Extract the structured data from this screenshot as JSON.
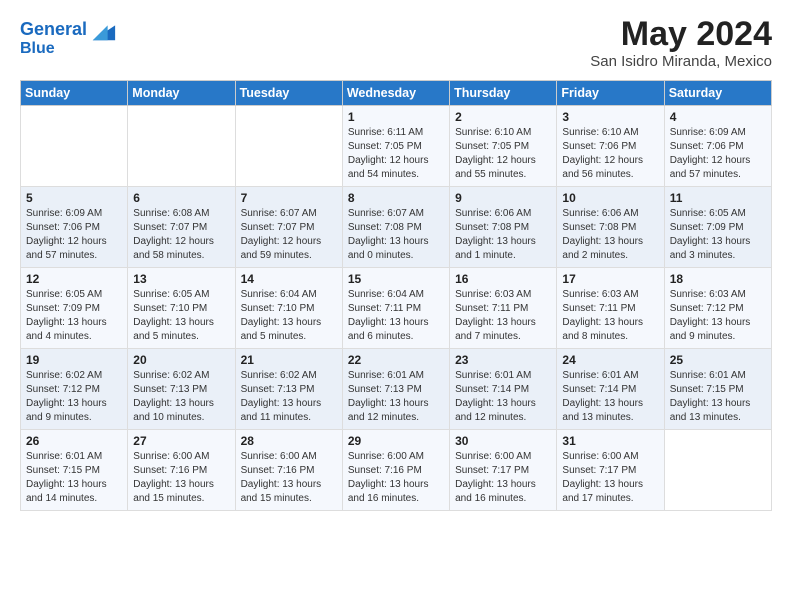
{
  "header": {
    "logo_line1": "General",
    "logo_line2": "Blue",
    "title": "May 2024",
    "subtitle": "San Isidro Miranda, Mexico"
  },
  "days_of_week": [
    "Sunday",
    "Monday",
    "Tuesday",
    "Wednesday",
    "Thursday",
    "Friday",
    "Saturday"
  ],
  "weeks": [
    [
      {
        "num": "",
        "info": ""
      },
      {
        "num": "",
        "info": ""
      },
      {
        "num": "",
        "info": ""
      },
      {
        "num": "1",
        "info": "Sunrise: 6:11 AM\nSunset: 7:05 PM\nDaylight: 12 hours\nand 54 minutes."
      },
      {
        "num": "2",
        "info": "Sunrise: 6:10 AM\nSunset: 7:05 PM\nDaylight: 12 hours\nand 55 minutes."
      },
      {
        "num": "3",
        "info": "Sunrise: 6:10 AM\nSunset: 7:06 PM\nDaylight: 12 hours\nand 56 minutes."
      },
      {
        "num": "4",
        "info": "Sunrise: 6:09 AM\nSunset: 7:06 PM\nDaylight: 12 hours\nand 57 minutes."
      }
    ],
    [
      {
        "num": "5",
        "info": "Sunrise: 6:09 AM\nSunset: 7:06 PM\nDaylight: 12 hours\nand 57 minutes."
      },
      {
        "num": "6",
        "info": "Sunrise: 6:08 AM\nSunset: 7:07 PM\nDaylight: 12 hours\nand 58 minutes."
      },
      {
        "num": "7",
        "info": "Sunrise: 6:07 AM\nSunset: 7:07 PM\nDaylight: 12 hours\nand 59 minutes."
      },
      {
        "num": "8",
        "info": "Sunrise: 6:07 AM\nSunset: 7:08 PM\nDaylight: 13 hours\nand 0 minutes."
      },
      {
        "num": "9",
        "info": "Sunrise: 6:06 AM\nSunset: 7:08 PM\nDaylight: 13 hours\nand 1 minute."
      },
      {
        "num": "10",
        "info": "Sunrise: 6:06 AM\nSunset: 7:08 PM\nDaylight: 13 hours\nand 2 minutes."
      },
      {
        "num": "11",
        "info": "Sunrise: 6:05 AM\nSunset: 7:09 PM\nDaylight: 13 hours\nand 3 minutes."
      }
    ],
    [
      {
        "num": "12",
        "info": "Sunrise: 6:05 AM\nSunset: 7:09 PM\nDaylight: 13 hours\nand 4 minutes."
      },
      {
        "num": "13",
        "info": "Sunrise: 6:05 AM\nSunset: 7:10 PM\nDaylight: 13 hours\nand 5 minutes."
      },
      {
        "num": "14",
        "info": "Sunrise: 6:04 AM\nSunset: 7:10 PM\nDaylight: 13 hours\nand 5 minutes."
      },
      {
        "num": "15",
        "info": "Sunrise: 6:04 AM\nSunset: 7:11 PM\nDaylight: 13 hours\nand 6 minutes."
      },
      {
        "num": "16",
        "info": "Sunrise: 6:03 AM\nSunset: 7:11 PM\nDaylight: 13 hours\nand 7 minutes."
      },
      {
        "num": "17",
        "info": "Sunrise: 6:03 AM\nSunset: 7:11 PM\nDaylight: 13 hours\nand 8 minutes."
      },
      {
        "num": "18",
        "info": "Sunrise: 6:03 AM\nSunset: 7:12 PM\nDaylight: 13 hours\nand 9 minutes."
      }
    ],
    [
      {
        "num": "19",
        "info": "Sunrise: 6:02 AM\nSunset: 7:12 PM\nDaylight: 13 hours\nand 9 minutes."
      },
      {
        "num": "20",
        "info": "Sunrise: 6:02 AM\nSunset: 7:13 PM\nDaylight: 13 hours\nand 10 minutes."
      },
      {
        "num": "21",
        "info": "Sunrise: 6:02 AM\nSunset: 7:13 PM\nDaylight: 13 hours\nand 11 minutes."
      },
      {
        "num": "22",
        "info": "Sunrise: 6:01 AM\nSunset: 7:13 PM\nDaylight: 13 hours\nand 12 minutes."
      },
      {
        "num": "23",
        "info": "Sunrise: 6:01 AM\nSunset: 7:14 PM\nDaylight: 13 hours\nand 12 minutes."
      },
      {
        "num": "24",
        "info": "Sunrise: 6:01 AM\nSunset: 7:14 PM\nDaylight: 13 hours\nand 13 minutes."
      },
      {
        "num": "25",
        "info": "Sunrise: 6:01 AM\nSunset: 7:15 PM\nDaylight: 13 hours\nand 13 minutes."
      }
    ],
    [
      {
        "num": "26",
        "info": "Sunrise: 6:01 AM\nSunset: 7:15 PM\nDaylight: 13 hours\nand 14 minutes."
      },
      {
        "num": "27",
        "info": "Sunrise: 6:00 AM\nSunset: 7:16 PM\nDaylight: 13 hours\nand 15 minutes."
      },
      {
        "num": "28",
        "info": "Sunrise: 6:00 AM\nSunset: 7:16 PM\nDaylight: 13 hours\nand 15 minutes."
      },
      {
        "num": "29",
        "info": "Sunrise: 6:00 AM\nSunset: 7:16 PM\nDaylight: 13 hours\nand 16 minutes."
      },
      {
        "num": "30",
        "info": "Sunrise: 6:00 AM\nSunset: 7:17 PM\nDaylight: 13 hours\nand 16 minutes."
      },
      {
        "num": "31",
        "info": "Sunrise: 6:00 AM\nSunset: 7:17 PM\nDaylight: 13 hours\nand 17 minutes."
      },
      {
        "num": "",
        "info": ""
      }
    ]
  ]
}
